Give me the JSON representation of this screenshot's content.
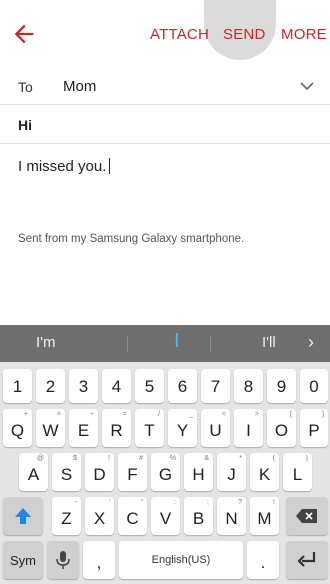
{
  "toolbar": {
    "back_icon": "back-arrow-icon",
    "attach": "ATTACH",
    "send": "SEND",
    "more": "MORE",
    "accent": "#c62828"
  },
  "compose": {
    "to_label": "To",
    "to_value": "Mom",
    "subject": "Hi",
    "body": "I missed you.",
    "signature": "Sent from my Samsung Galaxy smartphone."
  },
  "keyboard": {
    "suggestions": [
      "I'm",
      "I",
      "I'll"
    ],
    "row1": [
      "1",
      "2",
      "3",
      "4",
      "5",
      "6",
      "7",
      "8",
      "9",
      "0"
    ],
    "row2": [
      "Q",
      "W",
      "E",
      "R",
      "T",
      "Y",
      "U",
      "I",
      "O",
      "P"
    ],
    "row2_hints": [
      "+",
      "×",
      "÷",
      "=",
      "/",
      "_",
      "<",
      ">",
      "[",
      "]"
    ],
    "row3": [
      "A",
      "S",
      "D",
      "F",
      "G",
      "H",
      "J",
      "K",
      "L"
    ],
    "row3_hints": [
      "@",
      "$",
      "!",
      "#",
      "%",
      "&",
      "*",
      "(",
      ")"
    ],
    "row4": [
      "Z",
      "X",
      "C",
      "V",
      "B",
      "N",
      "M"
    ],
    "row4_hints": [
      "-",
      "'",
      "\"",
      ":",
      ";",
      "?",
      "!"
    ],
    "sym": "Sym",
    "comma": ",",
    "space": "English(US)",
    "period": "."
  }
}
